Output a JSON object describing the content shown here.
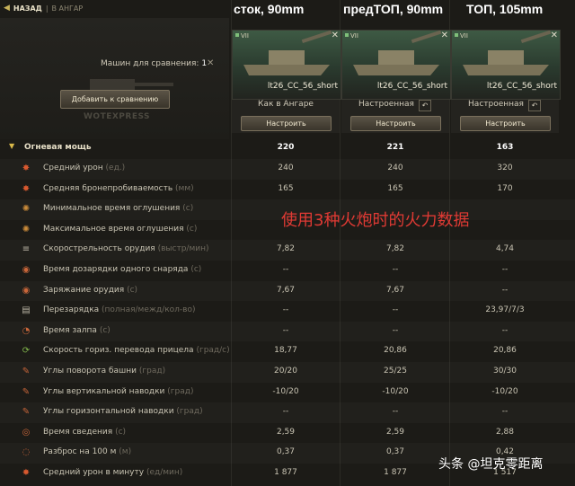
{
  "nav": {
    "back_label": "НАЗАД",
    "separator": "|",
    "crumb": "В АНГАР"
  },
  "headers": [
    "сток, 90mm",
    "предТОП, 90mm",
    "ТОП, 105mm"
  ],
  "compare": {
    "label": "Машин для сравнения:",
    "count": "1",
    "add_button": "Добавить к сравнению",
    "watermark": "WOTEXPRESS"
  },
  "cards": [
    {
      "tier": "VII",
      "name": "lt26_CC_56_short",
      "status": "Как в Ангаре",
      "configure": "Настроить",
      "undo": false
    },
    {
      "tier": "VII",
      "name": "lt26_CC_56_short",
      "status": "Настроенная",
      "configure": "Настроить",
      "undo": true
    },
    {
      "tier": "VII",
      "name": "lt26_CC_56_short",
      "status": "Настроенная",
      "configure": "Настроить",
      "undo": true
    }
  ],
  "category": {
    "label": "Огневая мощь",
    "values": [
      "220",
      "221",
      "163"
    ]
  },
  "rows": [
    {
      "icon": "damage-icon",
      "glyph": "✸",
      "color": "#d9592f",
      "label": "Средний урон",
      "unit": "(ед.)",
      "values": [
        "240",
        "240",
        "320"
      ]
    },
    {
      "icon": "penetration-icon",
      "glyph": "✸",
      "color": "#d9592f",
      "label": "Средняя бронепробиваемость",
      "unit": "(мм)",
      "values": [
        "165",
        "165",
        "170"
      ]
    },
    {
      "icon": "min-stun-icon",
      "glyph": "✺",
      "color": "#c98a3a",
      "label": "Минимальное время оглушения",
      "unit": "(с)",
      "values": [
        "",
        "",
        ""
      ]
    },
    {
      "icon": "max-stun-icon",
      "glyph": "✺",
      "color": "#c98a3a",
      "label": "Максимальное время оглушения",
      "unit": "(с)",
      "values": [
        "",
        "",
        ""
      ]
    },
    {
      "icon": "rate-of-fire-icon",
      "glyph": "≡",
      "color": "#b9b3a3",
      "label": "Скорострельность орудия",
      "unit": "(выстр/мин)",
      "values": [
        "7,82",
        "7,82",
        "4,74"
      ]
    },
    {
      "icon": "shell-reload-icon",
      "glyph": "◉",
      "color": "#c9663a",
      "label": "Время дозарядки одного снаряда",
      "unit": "(с)",
      "values": [
        "--",
        "--",
        "--"
      ]
    },
    {
      "icon": "loading-icon",
      "glyph": "◉",
      "color": "#c9663a",
      "label": "Заряжание орудия",
      "unit": "(с)",
      "values": [
        "7,67",
        "7,67",
        "--"
      ]
    },
    {
      "icon": "reload-icon",
      "glyph": "▤",
      "color": "#b9b3a3",
      "label": "Перезарядка",
      "unit": "(полная/межд/кол-во)",
      "values": [
        "--",
        "--",
        "23,97/7/3"
      ]
    },
    {
      "icon": "salvo-icon",
      "glyph": "◔",
      "color": "#c9663a",
      "label": "Время залпа",
      "unit": "(с)",
      "values": [
        "--",
        "--",
        "--"
      ]
    },
    {
      "icon": "traverse-icon",
      "glyph": "⟳",
      "color": "#7fb24a",
      "label": "Скорость гориз. перевода прицела",
      "unit": "(град/с)",
      "values": [
        "18,77",
        "20,86",
        "20,86"
      ]
    },
    {
      "icon": "turret-angles-icon",
      "glyph": "✎",
      "color": "#c9663a",
      "label": "Углы поворота башни",
      "unit": "(град)",
      "values": [
        "20/20",
        "25/25",
        "30/30"
      ]
    },
    {
      "icon": "vertical-angles-icon",
      "glyph": "✎",
      "color": "#c9663a",
      "label": "Углы вертикальной наводки",
      "unit": "(град)",
      "values": [
        "-10/20",
        "-10/20",
        "-10/20"
      ]
    },
    {
      "icon": "horizontal-angles-icon",
      "glyph": "✎",
      "color": "#c9663a",
      "label": "Углы горизонтальной наводки",
      "unit": "(град)",
      "values": [
        "--",
        "--",
        "--"
      ]
    },
    {
      "icon": "aim-time-icon",
      "glyph": "◎",
      "color": "#c9663a",
      "label": "Время сведения",
      "unit": "(с)",
      "values": [
        "2,59",
        "2,59",
        "2,88"
      ]
    },
    {
      "icon": "dispersion-icon",
      "glyph": "◌",
      "color": "#c9663a",
      "label": "Разброс на 100 м",
      "unit": "(м)",
      "values": [
        "0,37",
        "0,37",
        "0,42"
      ]
    },
    {
      "icon": "dpm-icon",
      "glyph": "✸",
      "color": "#d9592f",
      "label": "Средний урон в минуту",
      "unit": "(ед/мин)",
      "values": [
        "1 877",
        "1 877",
        "1 517"
      ]
    }
  ],
  "overlay": "使用3种火炮时的火力数据",
  "brand": "头条 @坦克零距离"
}
